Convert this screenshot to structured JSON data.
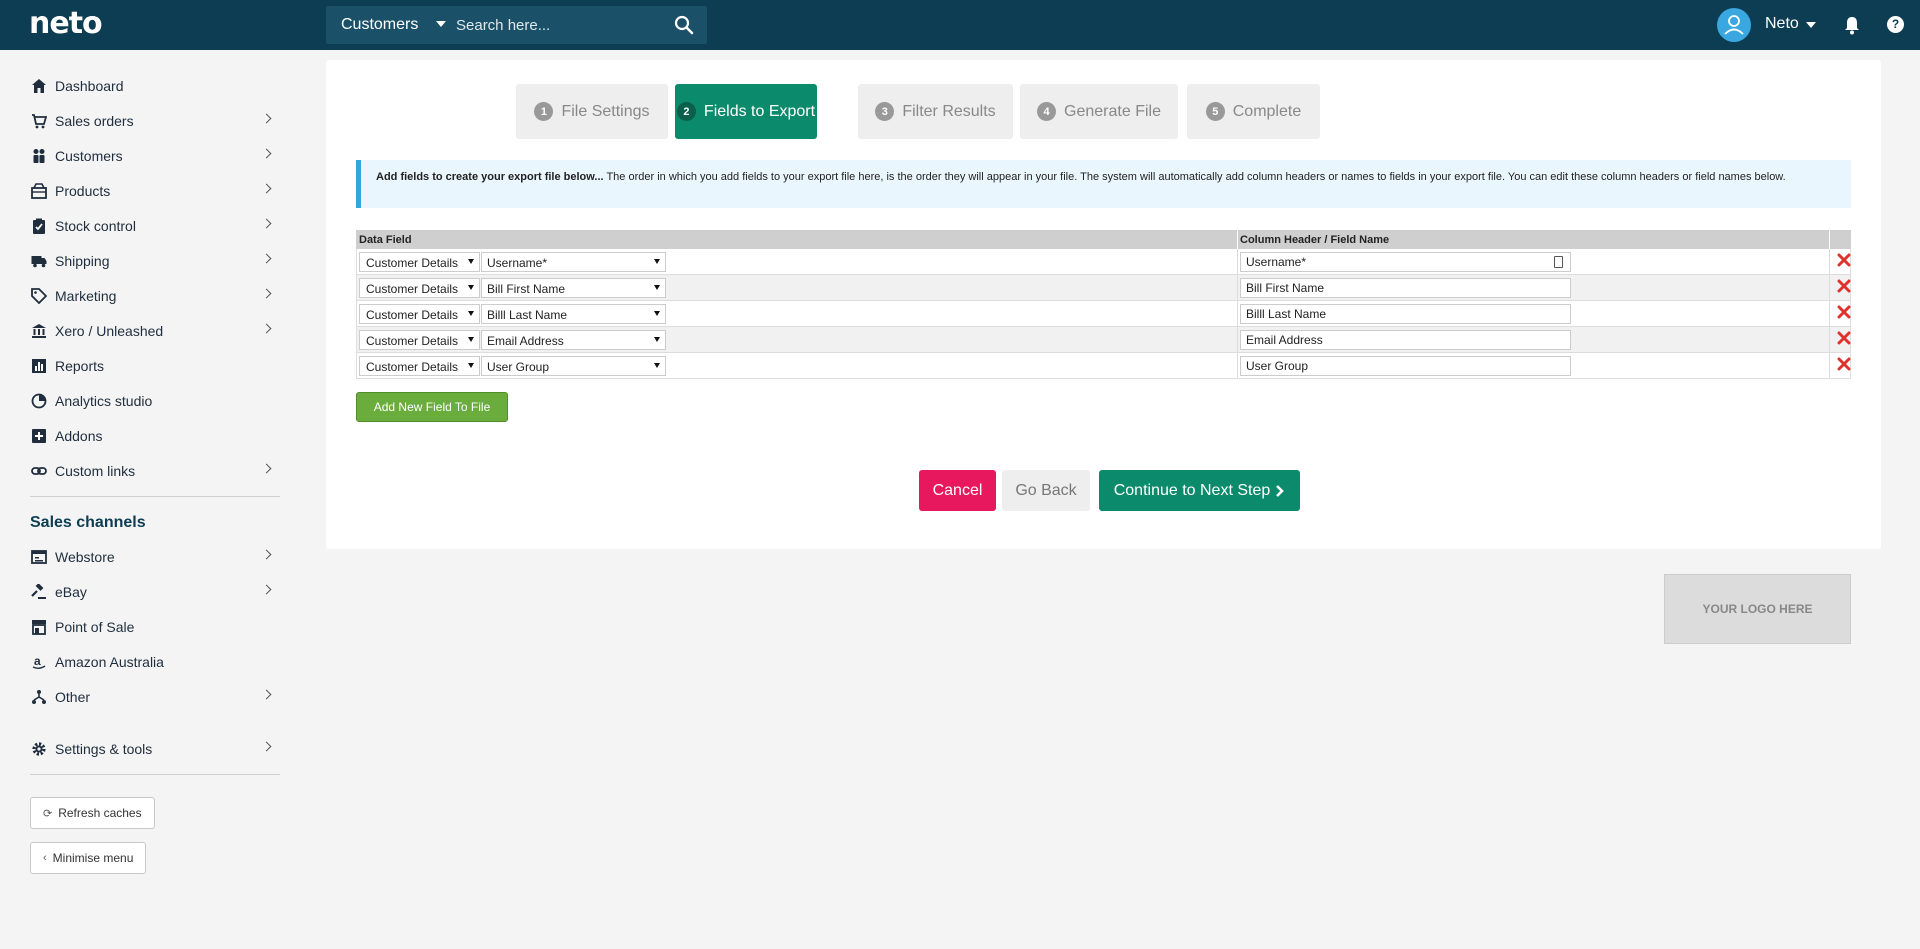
{
  "topbar": {
    "logo": "neto",
    "search_scope": "Customers",
    "search_placeholder": "Search here...",
    "user_name": "Neto",
    "help": "?"
  },
  "sidebar": {
    "items": [
      {
        "label": "Dashboard",
        "icon": "home-icon"
      },
      {
        "label": "Sales orders",
        "icon": "cart-icon"
      },
      {
        "label": "Customers",
        "icon": "users-icon"
      },
      {
        "label": "Products",
        "icon": "box-icon"
      },
      {
        "label": "Stock control",
        "icon": "clipboard-icon"
      },
      {
        "label": "Shipping",
        "icon": "truck-icon"
      },
      {
        "label": "Marketing",
        "icon": "tag-icon"
      },
      {
        "label": "Xero / Unleashed",
        "icon": "bank-icon"
      },
      {
        "label": "Reports",
        "icon": "chart-icon"
      },
      {
        "label": "Analytics studio",
        "icon": "analytics-icon"
      },
      {
        "label": "Addons",
        "icon": "plus-square-icon"
      },
      {
        "label": "Custom links",
        "icon": "link-icon"
      }
    ],
    "channels_heading": "Sales channels",
    "channels": [
      {
        "label": "Webstore",
        "icon": "webstore-icon"
      },
      {
        "label": "eBay",
        "icon": "gavel-icon"
      },
      {
        "label": "Point of Sale",
        "icon": "store-icon"
      },
      {
        "label": "Amazon Australia",
        "icon": "amazon-icon"
      },
      {
        "label": "Other",
        "icon": "sitemap-icon"
      }
    ],
    "settings": "Settings & tools",
    "refresh_caches": "Refresh caches",
    "minimise_menu": "Minimise menu"
  },
  "steps": [
    {
      "num": "1",
      "label": "File Settings"
    },
    {
      "num": "2",
      "label": "Fields to Export"
    },
    {
      "num": "3",
      "label": "Filter Results"
    },
    {
      "num": "4",
      "label": "Generate File"
    },
    {
      "num": "5",
      "label": "Complete"
    }
  ],
  "info": {
    "bold": "Add fields to create your export file below...",
    "text": " The order in which you add fields to your export file here, is the order they will appear in your file. The system will automatically add column headers or names to fields in your export file. You can edit these column headers or field names below."
  },
  "table": {
    "header_data_field": "Data Field",
    "header_column": "Column Header / Field Name",
    "rows": [
      {
        "category": "Customer Details",
        "field": "Username*",
        "column": "Username*"
      },
      {
        "category": "Customer Details",
        "field": "Bill First Name",
        "column": "Bill First Name"
      },
      {
        "category": "Customer Details",
        "field": "Billl Last Name",
        "column": "Billl Last Name"
      },
      {
        "category": "Customer Details",
        "field": "Email Address",
        "column": "Email Address"
      },
      {
        "category": "Customer Details",
        "field": "User Group",
        "column": "User Group"
      }
    ]
  },
  "buttons": {
    "add_field": "Add New Field To File",
    "cancel": "Cancel",
    "go_back": "Go Back",
    "next": "Continue to Next Step"
  },
  "logo_placeholder": "YOUR LOGO HERE",
  "colors": {
    "topbar": "#0d3d52",
    "accent": "#0c8a6c",
    "cancel": "#e8185f",
    "add": "#6aad3d"
  }
}
